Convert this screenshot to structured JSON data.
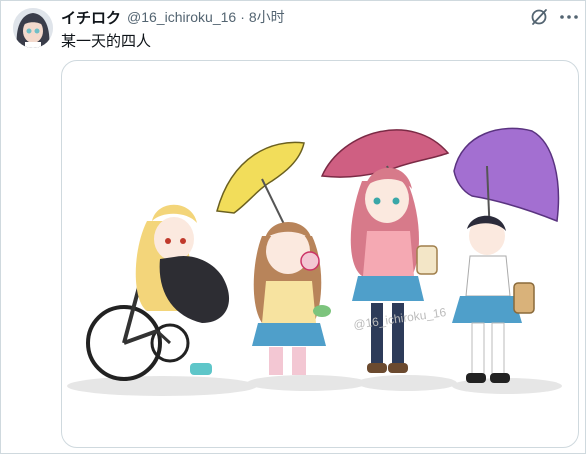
{
  "tweet": {
    "display_name": "イチロク",
    "handle": "@16_ichiroku_16",
    "separator": "·",
    "time": "8小时",
    "text": "某一天的四人"
  },
  "media": {
    "watermark": "@16_ichiroku_16",
    "colors": {
      "yellow_umbrella": "#f2dd5a",
      "pink_umbrella": "#cf5f82",
      "purple_umbrella": "#a36fd1",
      "skirt_blue": "#4f9fca"
    }
  },
  "icons": {
    "avatar": "avatar",
    "grok": "grok-icon",
    "more": "more-icon"
  }
}
